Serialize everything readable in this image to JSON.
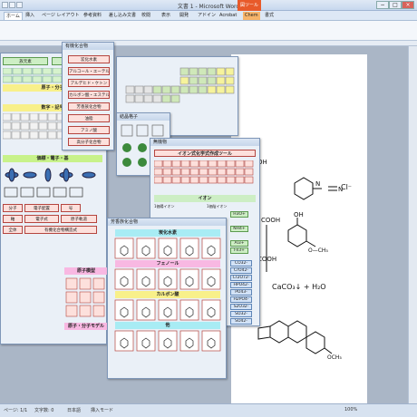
{
  "window": {
    "title": "文書 1 - Microsoft Word",
    "context_tab": "図ツール",
    "min": "−",
    "max": "□",
    "close": "×"
  },
  "ribbon_tabs": [
    "ホーム",
    "挿入",
    "ページ レイアウト",
    "参考資料",
    "差し込み文書",
    "校閲",
    "表示",
    "開発",
    "アドイン",
    "Acrobat",
    "Chem",
    "書式"
  ],
  "status": {
    "page": "ページ: 1/1",
    "words": "文字数: 0",
    "lang": "日本語",
    "mode": "挿入モード",
    "zoom": "100%"
  },
  "panel_organic": {
    "title": "有機化合物",
    "buttons": [
      "炭化水素",
      "アルコール・エーテル",
      "アルデヒド・ケトン",
      "カルボン酸・エステル",
      "芳香族化合物",
      "油脂",
      "アミノ酸",
      "高分子化合物"
    ]
  },
  "panel_periodic": {
    "buttons_left": [
      "族元素",
      "置換基(基)"
    ]
  },
  "panel_main": {
    "sec_bond": "原子・分子",
    "sec_num": "数字・記号",
    "sec_orbital": "価標・電子・基",
    "sec_atom_model": "原子模型",
    "sec_molecule": "原子・分子モデル",
    "buttons": [
      "電子配置",
      "電子式",
      "原子軌道",
      "有機化合物構造式"
    ],
    "small_buttons": [
      "分子",
      "号",
      "軸",
      "全体"
    ]
  },
  "panel_crystal": {
    "title": "結晶格子"
  },
  "panel_ion": {
    "title": "無機物",
    "tool_title": "イオン式化学式作成ツール",
    "section": "イオン",
    "sub_labels": [
      "1価陽イオン",
      "1価陰イオン",
      "2価陽イオン",
      "2価陰イオン",
      "3価陽イオン",
      "3価陰イオン"
    ],
    "ions": [
      "H3O+",
      "NH4+",
      "Al3+",
      "Fe3+",
      "CO32-",
      "CrO42-",
      "Cr2O72-",
      "HPO42-",
      "PO43-",
      "H2PO4-",
      "S2O32-",
      "SO32-",
      "HSO4-",
      "SO42-"
    ]
  },
  "panel_aromatic": {
    "title": "芳香族化合物",
    "sec1": "炭化水素",
    "sec2": "フェノール",
    "sec3": "カルボン酸",
    "sec4": "他"
  },
  "document": {
    "cl_label": "Cl⁻",
    "reaction": "CaCO₃↓ + H₂O",
    "cooh": "COOH",
    "ch3": "O—CH₃",
    "och3": "OCH₃",
    "oh": "OH",
    "c_label": "C",
    "h_label": "H"
  }
}
